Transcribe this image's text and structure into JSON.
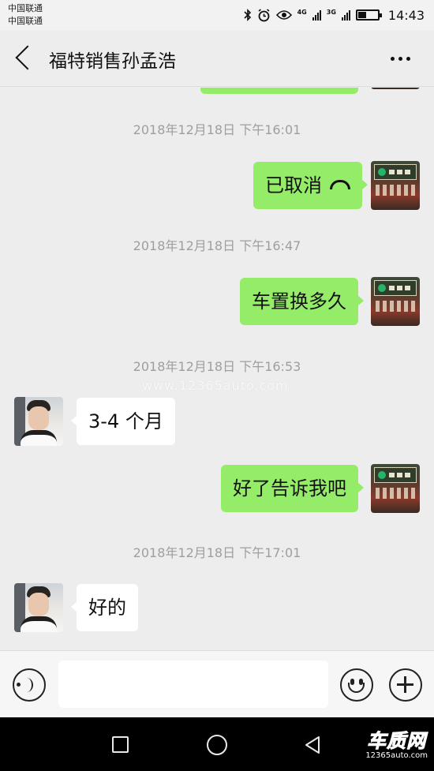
{
  "status_bar": {
    "carrier_1": "中国联通",
    "carrier_2": "中国联通",
    "net_1": "4G",
    "net_2": "3G",
    "battery_level": 0.4,
    "time": "14:43"
  },
  "nav": {
    "title": "福特销售孙孟浩"
  },
  "messages": [
    {
      "type": "time",
      "text": "2018年12月18日 下午16:01"
    },
    {
      "type": "sent",
      "text": "已取消",
      "icon": "phone-hangup-icon"
    },
    {
      "type": "time",
      "text": "2018年12月18日 下午16:47"
    },
    {
      "type": "sent",
      "text": "车置换多久"
    },
    {
      "type": "time",
      "text": "2018年12月18日 下午16:53"
    },
    {
      "type": "received",
      "text": "3-4 个月"
    },
    {
      "type": "sent",
      "text": "好了告诉我吧"
    },
    {
      "type": "time",
      "text": "2018年12月18日 下午17:01"
    },
    {
      "type": "received",
      "text": "好的"
    }
  ],
  "watermark": "www.12365auto.com",
  "input": {
    "value": "",
    "placeholder": ""
  },
  "logo": {
    "main": "车质网",
    "sub": "12365auto.com"
  },
  "colors": {
    "sent_bubble": "#95ec69",
    "received_bubble": "#ffffff",
    "chat_background": "#ededed",
    "logo_red": "#e21c23"
  }
}
